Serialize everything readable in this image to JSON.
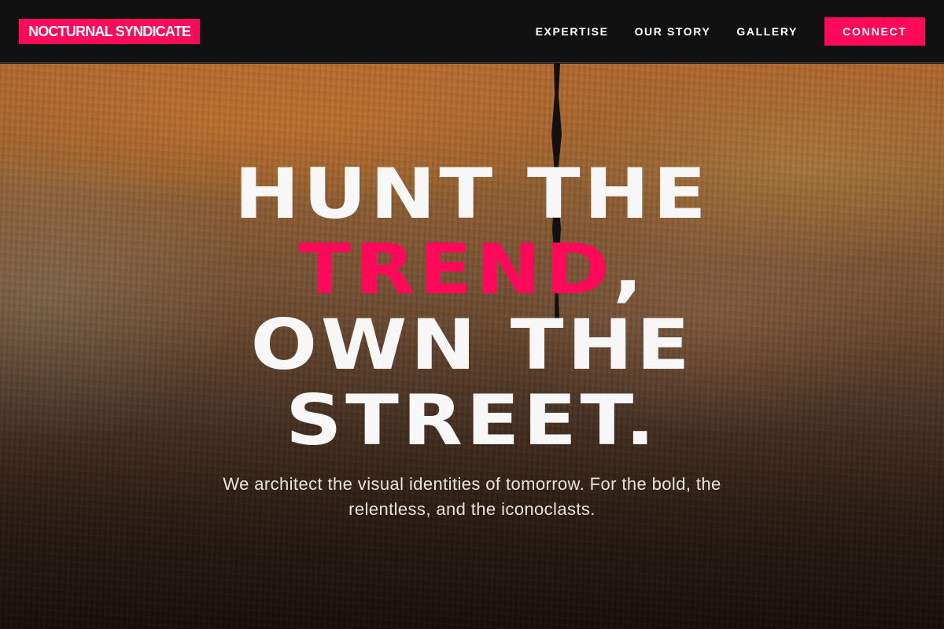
{
  "brand": {
    "name": "NOCTURNAL SYNDICATE",
    "accent_color": "#ff0a5a"
  },
  "nav": {
    "links": [
      {
        "label": "EXPERTISE"
      },
      {
        "label": "OUR STORY"
      },
      {
        "label": "GALLERY"
      }
    ],
    "cta_label": "CONNECT"
  },
  "hero": {
    "line1": "HUNT THE",
    "line2_accent": "TREND",
    "line2_suffix": ",",
    "line3": "OWN THE",
    "line4": "STREET.",
    "subtitle": "We architect the visual identities of tomorrow. For the bold, the relentless, and the iconoclasts."
  }
}
